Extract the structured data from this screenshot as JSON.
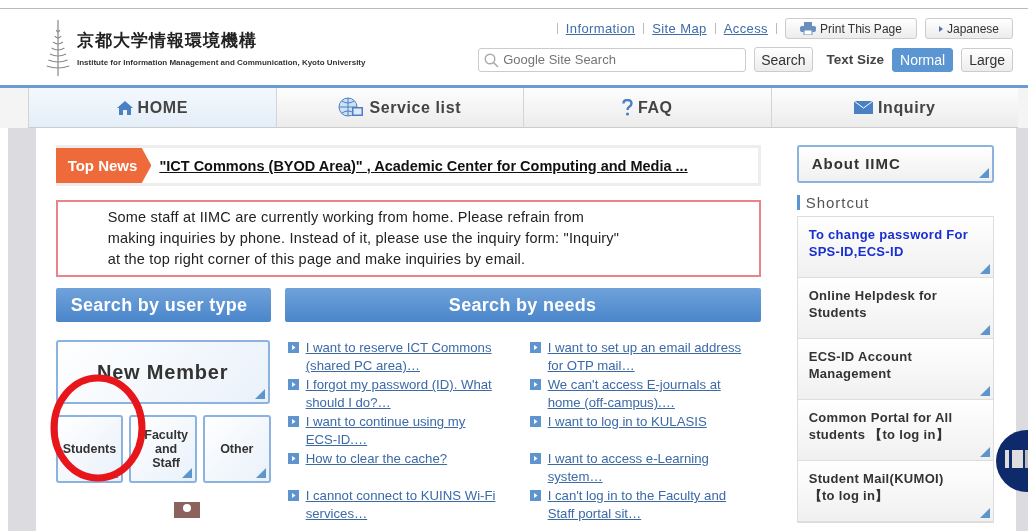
{
  "header": {
    "logo_title": "京都大学情報環境機構",
    "logo_subtitle": "Institute for Information Management and Communication, Kyoto University",
    "links": [
      "Information",
      "Site Map",
      "Access"
    ],
    "print_button": "Print This Page",
    "language_button": "Japanese",
    "search": {
      "placeholder": "Google Site Search",
      "button": "Search"
    },
    "text_size": {
      "label": "Text Size",
      "options": [
        {
          "label": "Normal",
          "selected": true
        },
        {
          "label": "Large",
          "selected": false
        }
      ]
    }
  },
  "nav": [
    {
      "label": "HOME",
      "kind": "home",
      "selected": true
    },
    {
      "label": "Service list",
      "kind": "globe",
      "selected": false
    },
    {
      "label": "FAQ",
      "kind": "question",
      "selected": false
    },
    {
      "label": "Inquiry",
      "kind": "mail",
      "selected": false
    }
  ],
  "top_news": {
    "label": "Top News",
    "headline": "\"ICT Commons (BYOD Area)\" , Academic Center for Computing and Media ..."
  },
  "notice": [
    "Some staff at IIMC are currently working from home. Please refrain from",
    "making inquiries by phone. Instead of it, please use the inquiry form: \"Inquiry\"",
    "at the top right corner of this page and make inquiries by email."
  ],
  "user_type": {
    "heading": "Search by user type",
    "main_button": "New Member",
    "buttons": [
      "Students",
      "Faculty and Staff",
      "Other"
    ]
  },
  "needs": {
    "heading": "Search by needs",
    "columns": [
      [
        "I want to reserve ICT Commons (shared PC area)…",
        "I forgot my password (ID). What should I do?…",
        "I want to continue using my ECS-ID.…",
        "How to clear the cache?",
        "I cannot connect to KUINS Wi-Fi services…"
      ],
      [
        "I want to set up an email address for OTP mail…",
        "We can't access E-journals at home (off-campus).…",
        "I want to log in to KULASIS",
        "I want to access e-Learning system…",
        "I can't log in to the Faculty and Staff portal sit…"
      ]
    ]
  },
  "sidebar": {
    "about": "About IIMC",
    "shortcut_heading": "Shortcut",
    "shortcuts": [
      {
        "label": "To change password For SPS-ID,ECS-ID",
        "highlighted": true
      },
      {
        "label": "Online Helpdesk for Students",
        "highlighted": false
      },
      {
        "label": "ECS-ID Account Management",
        "highlighted": false
      },
      {
        "label": "Common Portal for All students 【to log in】",
        "highlighted": false
      },
      {
        "label": "Student Mail(KUMOI) 【to log in】",
        "highlighted": false
      }
    ]
  }
}
